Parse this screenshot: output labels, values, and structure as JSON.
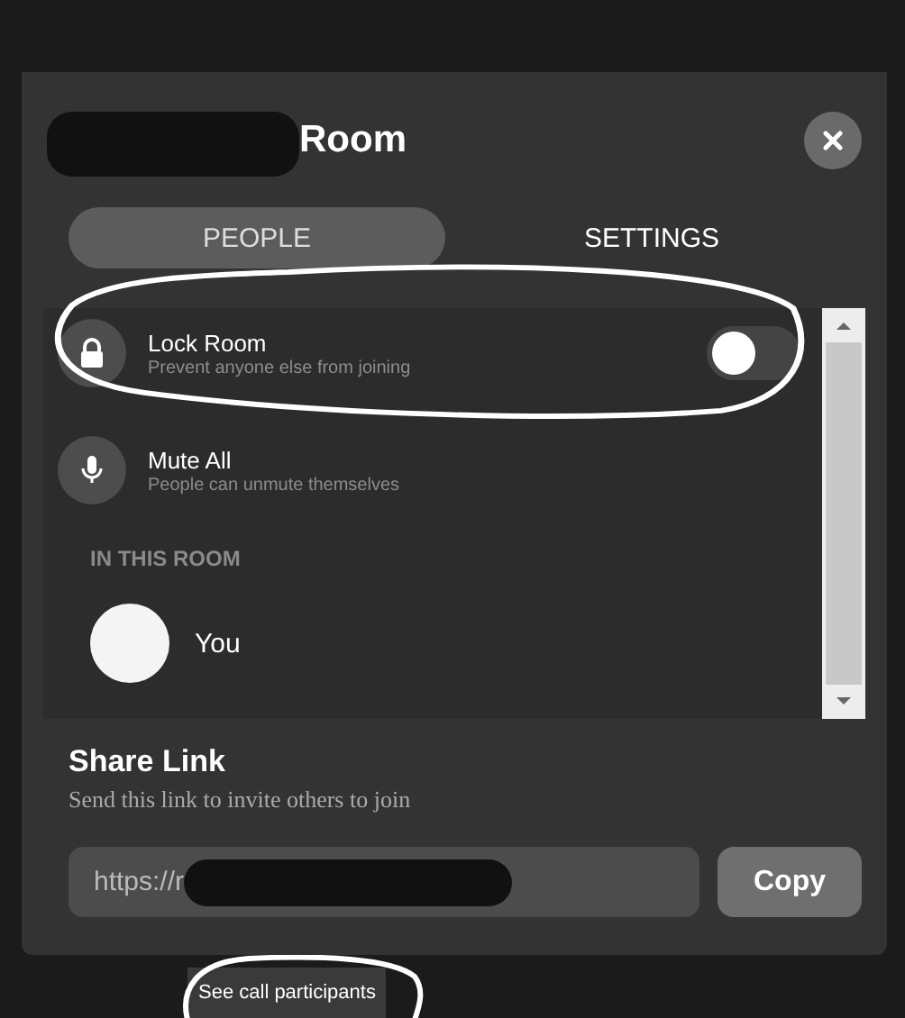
{
  "dialog": {
    "title": "Room"
  },
  "tabs": [
    {
      "label": "PEOPLE",
      "selected": true
    },
    {
      "label": "SETTINGS",
      "selected": false
    }
  ],
  "controls": [
    {
      "kind": "toggle",
      "title": "Lock Room",
      "subtitle": "Prevent anyone else from joining",
      "on": false
    },
    {
      "kind": "action",
      "title": "Mute All",
      "subtitle": "People can unmute themselves"
    }
  ],
  "section_heading": "IN THIS ROOM",
  "participants": [
    {
      "name": "You"
    }
  ],
  "share": {
    "title": "Share Link",
    "subtitle": "Send this link to invite others to join",
    "link": "https://r",
    "button": "Copy"
  },
  "tooltip": "See call participants"
}
